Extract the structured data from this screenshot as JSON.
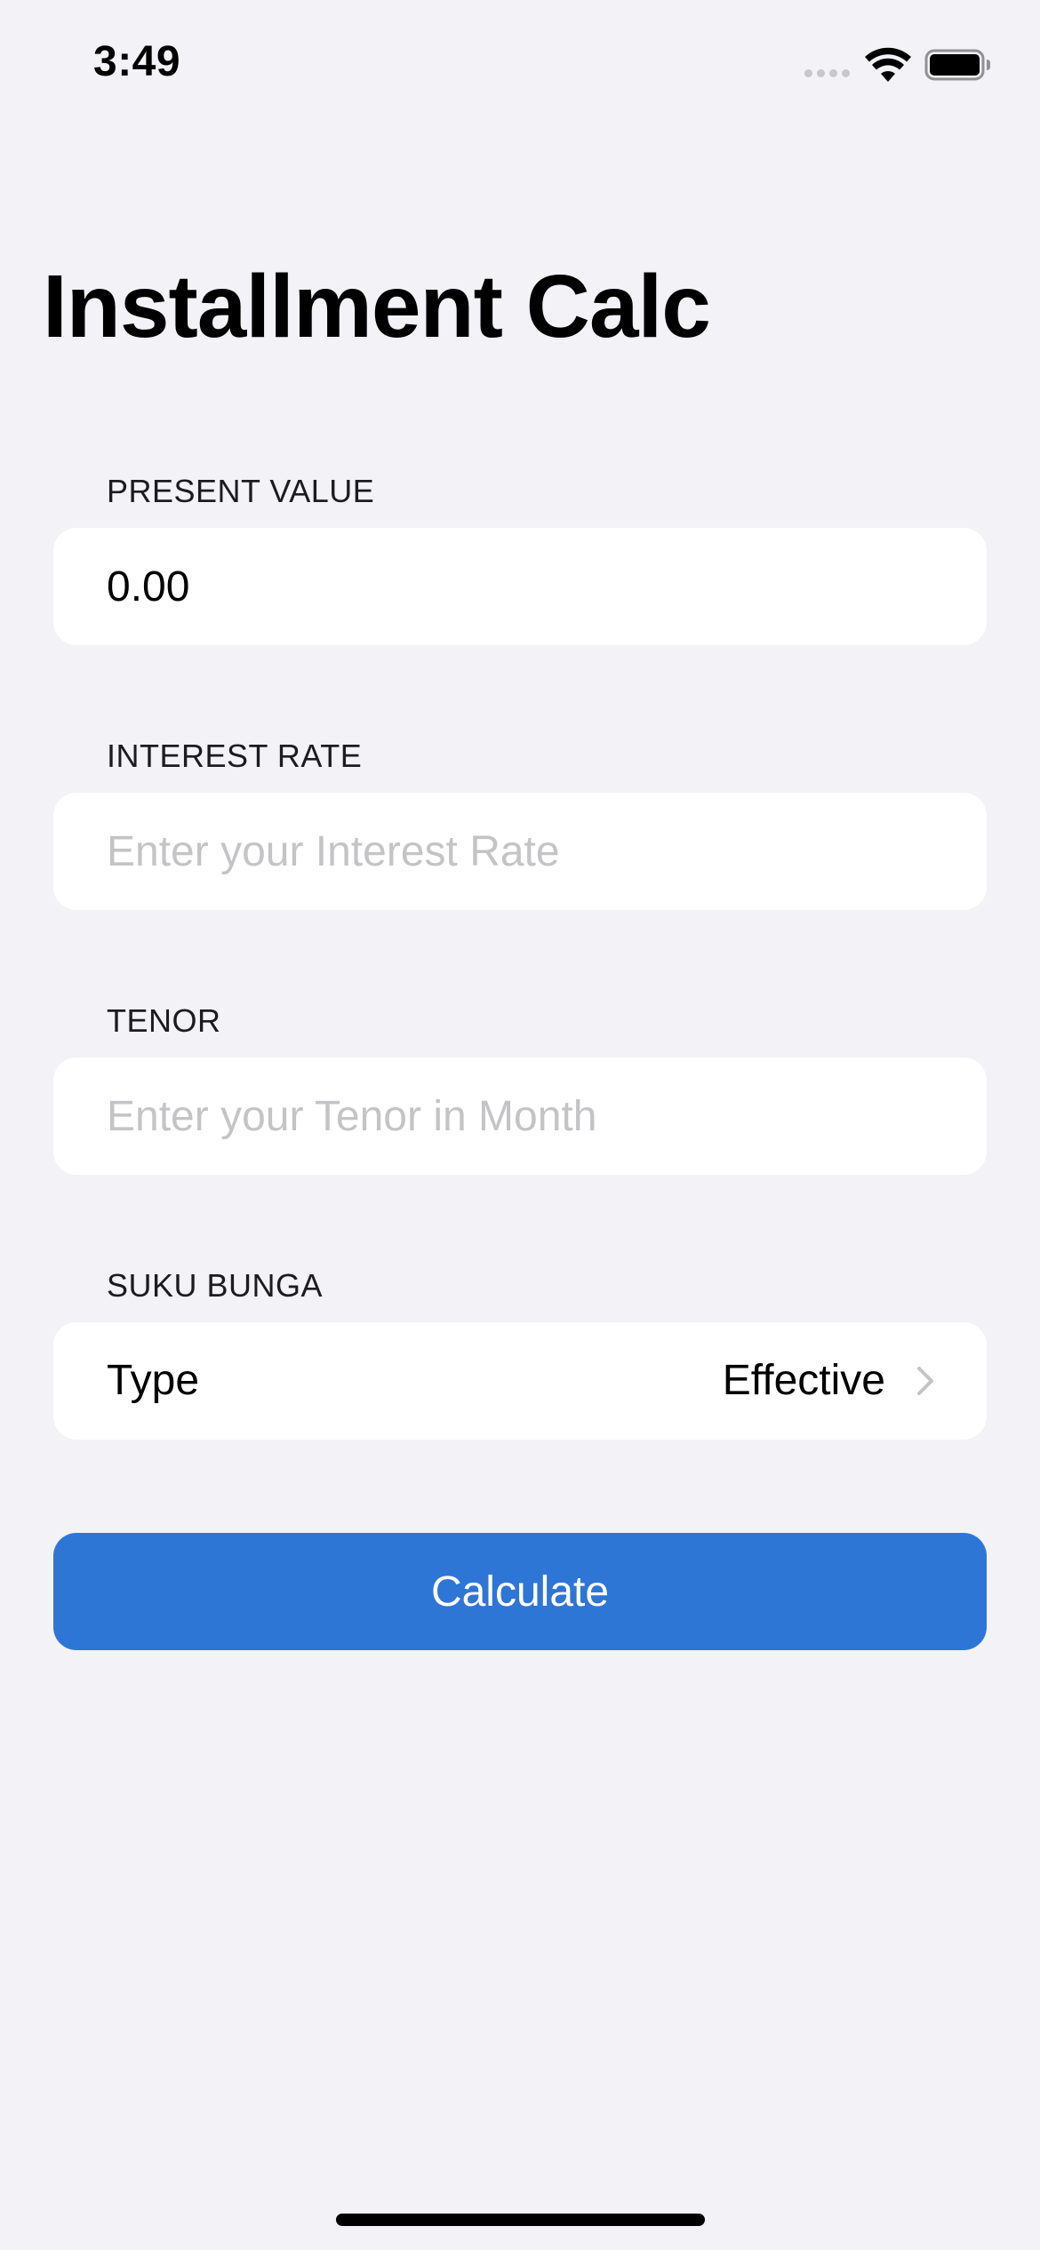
{
  "status_bar": {
    "time": "3:49"
  },
  "title": "Installment Calc",
  "form": {
    "present_value": {
      "header": "PRESENT VALUE",
      "value": "0.00",
      "placeholder": ""
    },
    "interest_rate": {
      "header": "INTEREST RATE",
      "value": "",
      "placeholder": "Enter your Interest Rate"
    },
    "tenor": {
      "header": "TENOR",
      "value": "",
      "placeholder": "Enter your Tenor in Month"
    },
    "suku_bunga": {
      "header": "SUKU BUNGA",
      "label": "Type",
      "selected": "Effective"
    }
  },
  "calculate_label": "Calculate",
  "colors": {
    "background": "#f2f2f7",
    "accent": "#2e76d6",
    "placeholder": "#c4c4c7"
  },
  "icons": {
    "wifi": "wifi-icon",
    "battery": "battery-icon",
    "cellular": "cellular-signal-icon",
    "chevron": "chevron-right-icon"
  }
}
